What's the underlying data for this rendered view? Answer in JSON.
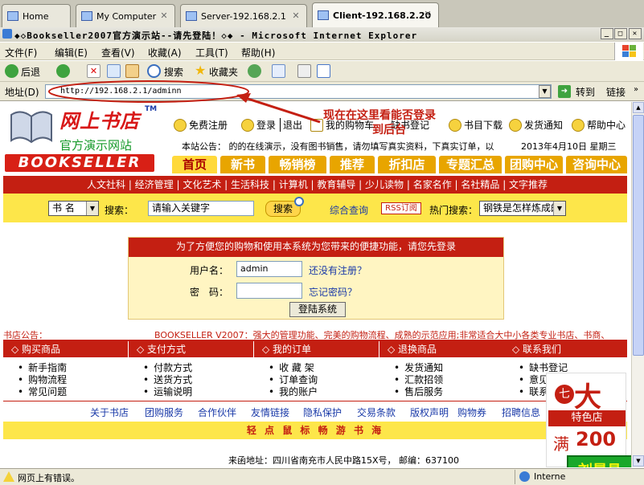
{
  "tabs": [
    {
      "label": "Home",
      "active": false
    },
    {
      "label": "My Computer",
      "active": false
    },
    {
      "label": "Server-192.168.2.1",
      "active": false
    },
    {
      "label": "Client-192.168.2.20",
      "active": true
    }
  ],
  "window": {
    "title": "◆◇Bookseller2007官方演示站--请先登陆！◇◆ - Microsoft Internet Explorer",
    "min": "_",
    "max": "□",
    "close": "✕"
  },
  "menu": [
    "文件(F)",
    "编辑(E)",
    "查看(V)",
    "收藏(A)",
    "工具(T)",
    "帮助(H)"
  ],
  "toolbar": {
    "back": "后退",
    "search": "搜索",
    "favorites": "收藏夹"
  },
  "address": {
    "label": "地址(D)",
    "url": "http://192.168.2.1/adminn",
    "go": "转到",
    "links": "链接"
  },
  "annotation": {
    "line1": "现在在这里看能否登录",
    "line2": "到后台"
  },
  "site": {
    "logo_title": "网上书店",
    "logo_tm": "TM",
    "logo_sub": "官方演示网站",
    "logo_en": "BOOKSELLER",
    "top_links": [
      "免费注册",
      "登录",
      "退出",
      "我的购物车",
      "缺书登记",
      "书目下载",
      "发货通知",
      "帮助中心"
    ],
    "notice": "本站公告：  的的在线演示，没有图书销售，请勿填写真实资料，下真实订单，以",
    "date": "2013年4月10日 星期三",
    "nav": [
      "首页",
      "新书",
      "畅销榜",
      "推荐",
      "折扣店",
      "专题汇总",
      "团购中心",
      "咨询中心"
    ],
    "categories": "人文社科 | 经济管理 | 文化艺术 | 生活科技 | 计算机 | 教育辅导 | 少儿读物 | 名家名作 | 名社精品 | 文字推荐",
    "search": {
      "type": "书 名",
      "label": "搜索：",
      "placeholder": "请输入关键字",
      "button": "搜索",
      "combined": "综合查询",
      "rss": "RSS订阅",
      "hot_label": "热门搜索：",
      "hot_value": "钢铁是怎样炼成的"
    },
    "login": {
      "header": "为了方便您的购物和使用本系统为您带来的便捷功能，请您先登录",
      "user_label": "用户名：",
      "user_value": "admin",
      "reg_link": "还没有注册？",
      "pwd_label": "密　码：",
      "pwd_value": "",
      "forgot": "忘记密码？",
      "submit": "登陆系统"
    },
    "announce_label": "书店公告：",
    "announce_text": "BOOKSELLER V2007：强大的管理功能、完美的购物流程、成熟的示范应用;非常适合大中小各类专业书店、书商、",
    "columns": [
      {
        "title": "购买商品",
        "items": [
          "新手指南",
          "购物流程",
          "常见问题"
        ]
      },
      {
        "title": "支付方式",
        "items": [
          "付款方式",
          "送货方式",
          "运输说明"
        ]
      },
      {
        "title": "我的订单",
        "items": [
          "收 藏 架",
          "订单查询",
          "我的账户"
        ]
      },
      {
        "title": "退换商品",
        "items": [
          "发货通知",
          "汇款招领",
          "售后服务"
        ]
      },
      {
        "title": "联系我们",
        "items": [
          "缺书登记",
          "意见",
          "联系"
        ]
      }
    ],
    "footer_links": [
      "关于书店",
      "团购服务",
      "合作伙伴",
      "友情链接",
      "隐私保护",
      "交易条款",
      "版权声明",
      "购物券",
      "招聘信息"
    ],
    "slogan": "轻 点 鼠 标      畅 游 书 海",
    "address_line": "来函地址：四川省南充市人民中路15X号，  邮编：637100",
    "ad": {
      "big": "大",
      "small": "七",
      "store": "特色店",
      "man": "满",
      "num": "200",
      "watermark": "刘晨昌"
    }
  },
  "status": {
    "text": "网页上有错误。",
    "zone": "Interne"
  }
}
